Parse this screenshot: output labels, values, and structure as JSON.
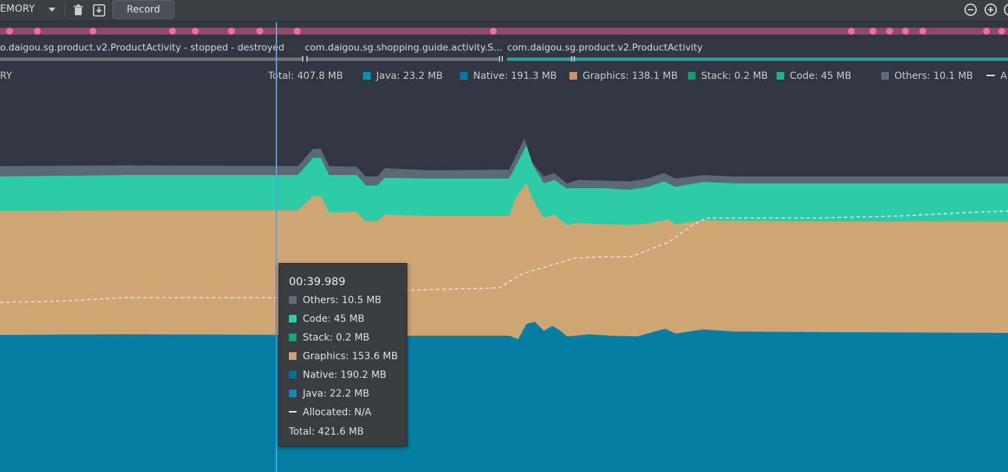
{
  "toolbar": {
    "title": "EMORY",
    "record_label": "Record"
  },
  "activities": [
    {
      "label": "o.daigou.sg.product.v2.ProductActivity - stopped - destroyed"
    },
    {
      "label": "com.daigou.sg.shopping.guide.activity.S..."
    },
    {
      "label": "com.daigou.sg.product.v2.ProductActivity"
    }
  ],
  "legend": {
    "category_label": "RY",
    "total": "Total: 407.8 MB",
    "items": [
      {
        "label": "Java: 23.2 MB",
        "color": "#0a8fb5"
      },
      {
        "label": "Native: 191.3 MB",
        "color": "#0b78a0"
      },
      {
        "label": "Graphics: 138.1 MB",
        "color": "#c8946a"
      },
      {
        "label": "Stack: 0.2 MB",
        "color": "#139a73"
      },
      {
        "label": "Code: 45 MB",
        "color": "#24b08c"
      },
      {
        "label": "Others: 10.1 MB",
        "color": "#5d6f7a"
      },
      {
        "label": "A",
        "color": "#e8e8e8"
      }
    ]
  },
  "tooltip": {
    "time": "00:39.989",
    "rows": [
      {
        "label": "Others: 10.5 MB",
        "color": "#5d6f7a"
      },
      {
        "label": "Code: 45 MB",
        "color": "#2ecfa7"
      },
      {
        "label": "Stack: 0.2 MB",
        "color": "#1aa67c"
      },
      {
        "label": "Graphics: 153.6 MB",
        "color": "#d1a277"
      },
      {
        "label": "Native: 190.2 MB",
        "color": "#0b6e93"
      },
      {
        "label": "Java: 22.2 MB",
        "color": "#0e8ab4"
      },
      {
        "label": "Allocated: N/A",
        "color": "#ffffff"
      }
    ],
    "total": "Total: 421.6 MB"
  },
  "colors": {
    "background": "#313640",
    "others": "#596a75",
    "code": "#2ccda6",
    "graphics": "#cfa574",
    "native": "#047ea2",
    "event_lane": "#8a4e63",
    "event_dot": "#e9729b",
    "activity_active": "#13a89a",
    "cursor": "#5a9ee6"
  }
}
